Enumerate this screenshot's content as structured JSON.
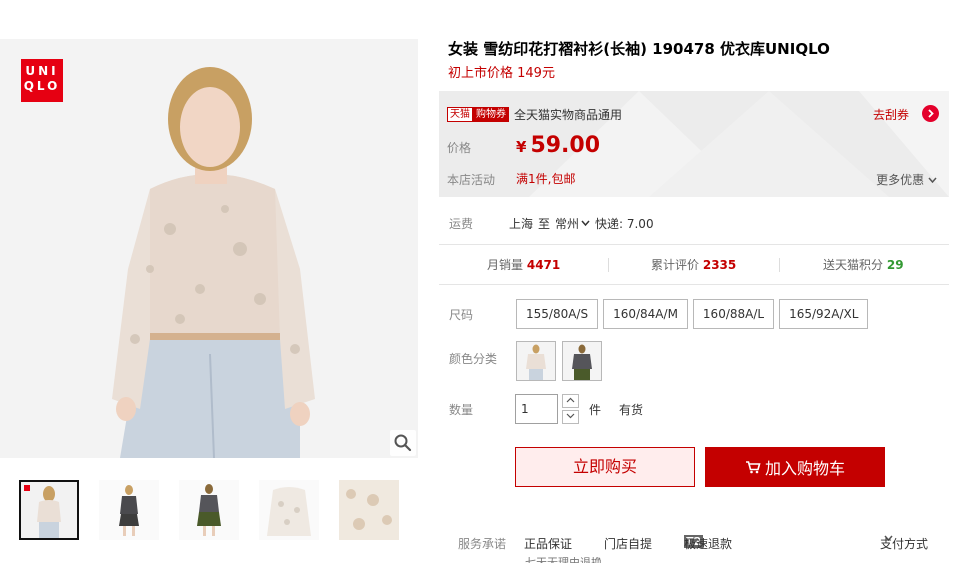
{
  "brand": {
    "logo_lines": [
      "UNI",
      "QLO"
    ],
    "logo_color": "#e60012"
  },
  "gallery": {
    "zoom_icon": "search-icon",
    "thumbnail_count": 5
  },
  "product": {
    "title": "女装 雪纺印花打褶衬衫(长袖) 190478 优衣库UNIQLO",
    "launch_price": "初上市价格 149元"
  },
  "promo_panel": {
    "tmall_tag": "天猫",
    "coupon_tag": "购物券",
    "coupon_text": "全天猫实物商品通用",
    "scratch_label": "去刮券",
    "price_label": "价格",
    "currency": "¥",
    "price": "59.00",
    "store_activity_label": "本店活动",
    "store_activity": "满1件,包邮",
    "more_offers": "更多优惠"
  },
  "shipping": {
    "label": "运费",
    "from": "上海",
    "to_word": "至",
    "destination": "常州",
    "express": "快递: 7.00"
  },
  "stats": {
    "monthly_sales_label": "月销量",
    "monthly_sales": "4471",
    "reviews_label": "累计评价",
    "reviews": "2335",
    "points_label": "送天猫积分",
    "points": "29"
  },
  "options": {
    "size_label": "尺码",
    "sizes": [
      "155/80A/S",
      "160/84A/M",
      "160/88A/L",
      "165/92A/XL"
    ],
    "color_label": "颜色分类",
    "quantity_label": "数量",
    "quantity": "1",
    "unit": "件",
    "stock": "有货"
  },
  "actions": {
    "buy_now": "立即购买",
    "add_to_cart": "加入购物车",
    "accent": "#c40000"
  },
  "service": {
    "label": "服务承诺",
    "genuine": "正品保证",
    "store_pickup": "门店自提",
    "t2_badge": "T2",
    "fast_refund": "极速退款",
    "payment": "支付方式",
    "overflow_text": "七天无理由退换"
  }
}
